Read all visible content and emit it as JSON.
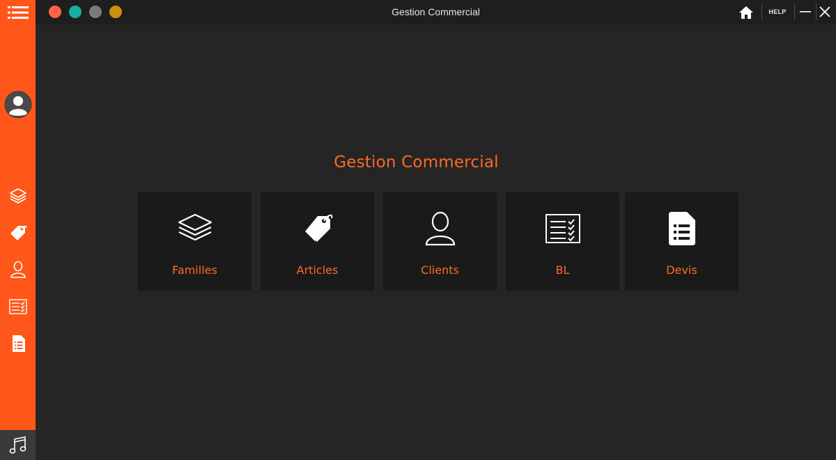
{
  "window": {
    "title": "Gestion Commercial"
  },
  "titlebar": {
    "help_label": "HELP",
    "traffic_lights": [
      "#fe6349",
      "#14b0a4",
      "#7b7b7b",
      "#c8900e"
    ]
  },
  "colors": {
    "accent": "#fe5719",
    "text_accent": "#fe6a26",
    "background": "#252525",
    "tile_background": "#1a1a1a"
  },
  "main": {
    "heading": "Gestion Commercial",
    "tiles": [
      {
        "label": "Familles",
        "icon": "layers-icon"
      },
      {
        "label": "Articles",
        "icon": "price-tags-icon"
      },
      {
        "label": "Clients",
        "icon": "user-icon"
      },
      {
        "label": "BL",
        "icon": "checklist-icon"
      },
      {
        "label": "Devis",
        "icon": "document-icon"
      }
    ]
  },
  "sidebar": {
    "items": [
      {
        "icon": "menu-icon"
      },
      {
        "icon": "user-avatar-icon"
      },
      {
        "icon": "layers-icon"
      },
      {
        "icon": "price-tags-icon"
      },
      {
        "icon": "user-icon"
      },
      {
        "icon": "checklist-icon"
      },
      {
        "icon": "document-icon"
      },
      {
        "icon": "music-icon"
      }
    ]
  }
}
